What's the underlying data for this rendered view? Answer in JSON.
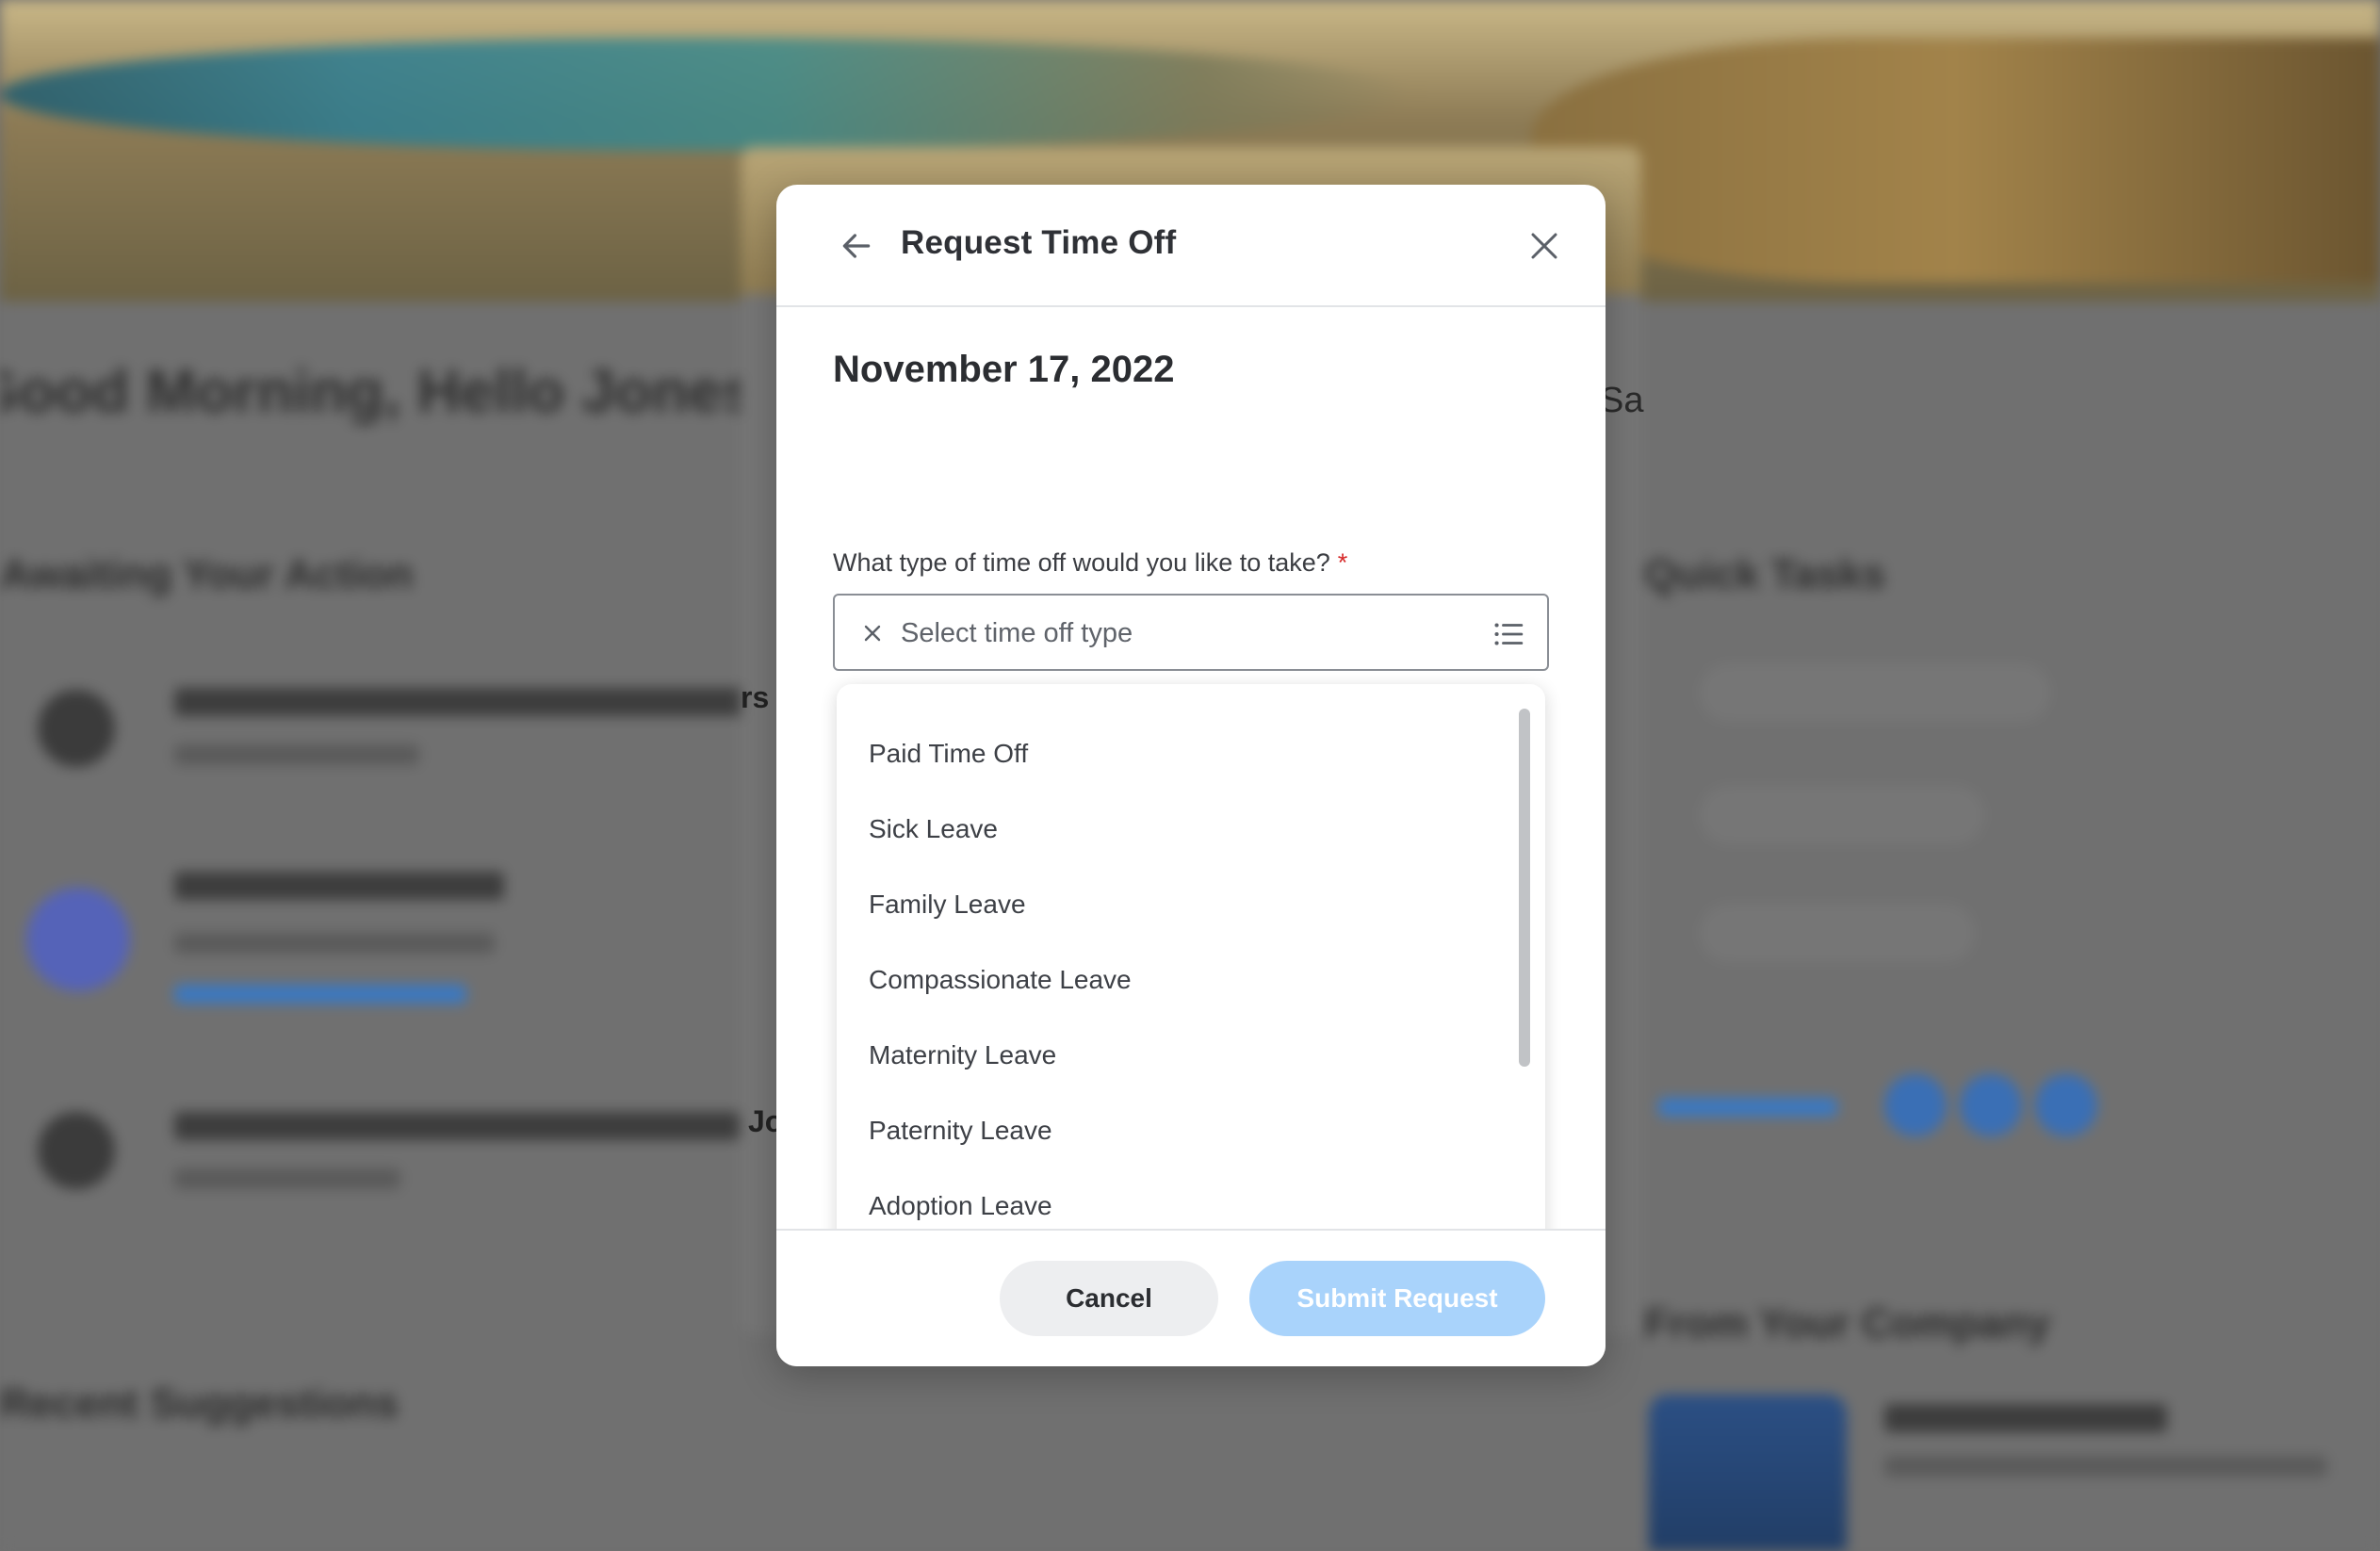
{
  "background": {
    "greeting": "Good Morning, Hello Jones",
    "section_left": "Awaiting Your Action",
    "section_right": "Quick Tasks",
    "section_bottom_left": "Recent Suggestions",
    "section_bottom_right": "From Your Company",
    "edge_text_1": "rs",
    "edge_text_2": "Jo",
    "edge_text_3": "Sa"
  },
  "modal": {
    "title": "Request Time Off",
    "date_heading": "November 17, 2022",
    "question": "What type of time off would you like to take?",
    "required_mark": "*",
    "select": {
      "placeholder": "Select time off type"
    },
    "dropdown_options": [
      "Paid Time Off",
      "Sick Leave",
      "Family Leave",
      "Compassionate Leave",
      "Maternity Leave",
      "Paternity Leave",
      "Adoption Leave"
    ],
    "footer": {
      "cancel_label": "Cancel",
      "submit_label": "Submit Request"
    }
  },
  "icons": {
    "back": "arrow-left-icon",
    "close": "close-icon",
    "clear": "clear-x-icon",
    "list": "list-icon"
  },
  "colors": {
    "submit_disabled": "#a9d3fb",
    "required": "#d62828",
    "overlay": "#6f6f6f"
  }
}
